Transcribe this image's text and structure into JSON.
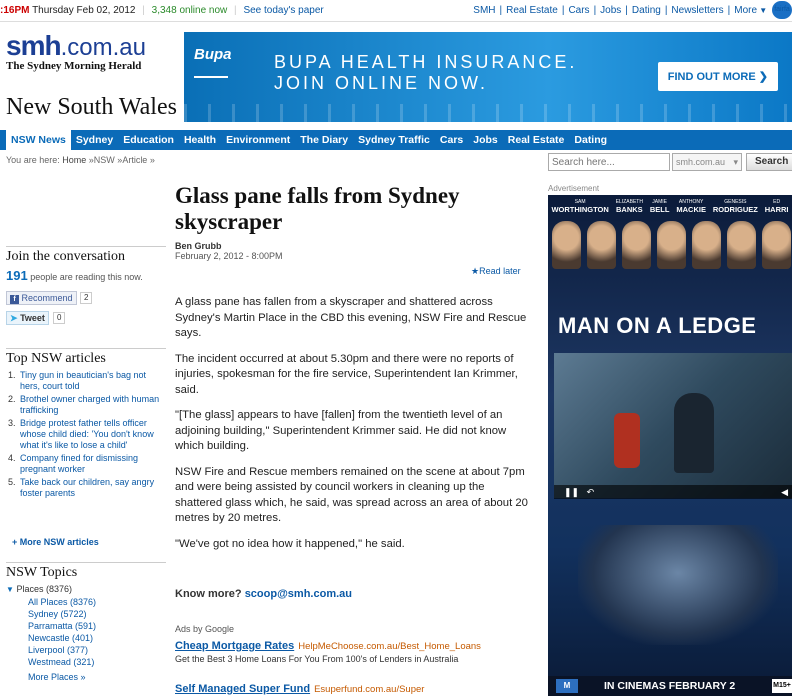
{
  "topbar": {
    "time": ":16PM",
    "date": "Thursday Feb 02, 2012",
    "online": "3,348 online now",
    "paper_link": "See today's paper",
    "links": [
      "SMH",
      "Real Estate",
      "Cars",
      "Jobs",
      "Dating",
      "Newsletters",
      "More"
    ],
    "fairfax": "fairfa"
  },
  "logo": {
    "smh": "smh",
    "domain": ".com.au",
    "masthead": "The Sydney Morning Herald"
  },
  "section_title": "New South Wales",
  "banner": {
    "brand": "Bupa",
    "headline_1": "BUPA HEALTH INSURANCE.",
    "headline_2": "JOIN ONLINE NOW.",
    "cta": "FIND OUT MORE ❯",
    "brand_color": "#0a6fb6"
  },
  "nav": {
    "items": [
      "NSW News",
      "Sydney",
      "Education",
      "Health",
      "Environment",
      "The Diary",
      "Sydney Traffic",
      "Cars",
      "Jobs",
      "Real Estate",
      "Dating"
    ],
    "color": "#0b6bb8"
  },
  "breadcrumb": {
    "prefix": "You are here:",
    "home": "Home",
    "sep": "»",
    "nsw": "NSW",
    "article": "Article"
  },
  "search": {
    "placeholder": "Search here...",
    "scope": "smh.com.au",
    "button": "Search"
  },
  "join": {
    "heading": "Join the conversation",
    "count": "191",
    "count_suffix": "people are reading this now.",
    "recommend": "Recommend",
    "recommend_count": "2",
    "tweet": "Tweet",
    "tweet_count": "0"
  },
  "top_articles": {
    "heading": "Top NSW articles",
    "items": [
      "Tiny gun in beautician's bag not hers, court told",
      "Brothel owner charged with human trafficking",
      "Bridge protest father tells officer whose child died: 'You don't know what it's like to lose a child'",
      "Company fined for dismissing pregnant worker",
      "Take back our children, say angry foster parents"
    ],
    "more": "More NSW articles"
  },
  "topics": {
    "heading": "NSW Topics",
    "places_header": "Places (8376)",
    "places": [
      "All Places (8376)",
      "Sydney (5722)",
      "Parramatta (591)",
      "Newcastle (401)",
      "Liverpool (377)",
      "Westmead (321)"
    ],
    "more": "More Places »"
  },
  "article": {
    "headline": "Glass pane falls from Sydney skyscraper",
    "author": "Ben Grubb",
    "date": "February 2, 2012 - 8:00PM",
    "read_later": "★Read later",
    "paragraphs": [
      "A glass pane has fallen from a skyscraper and shattered across Sydney's Martin Place in the CBD this evening, NSW Fire and Rescue says.",
      "The incident occurred at about 5.30pm and there were no reports of injuries, spokesman for the fire service, Superintendent Ian Krimmer, said.",
      "\"[The glass] appears to have [fallen] from the twentieth level of an adjoining building,\" Superintendent Krimmer said. He did not know which building.",
      "NSW Fire and Rescue members remained on the scene at about 7pm and were being assisted by council workers in cleaning up the shattered glass which, he said, was spread across an area of about 20 metres by 20 metres.",
      "\"We've got no idea how it happened,\" he said."
    ],
    "know_more": "Know more?",
    "know_more_email": "scoop@smh.com.au",
    "ads_by": "Ads by Google",
    "ads": [
      {
        "title": "Cheap Mortgage Rates",
        "url": "HelpMeChoose.com.au/Best_Home_Loans",
        "desc": "Get the Best 3 Home Loans For You From 100's of Lenders in Australia"
      },
      {
        "title": "Self Managed Super Fund",
        "url": "Esuperfund.com.au/Super",
        "desc": ""
      }
    ]
  },
  "right_ad": {
    "label": "Advertisement",
    "cast": [
      {
        "first": "SAM",
        "last": "WORTHINGTON"
      },
      {
        "first": "ELIZABETH",
        "last": "BANKS"
      },
      {
        "first": "JAMIE",
        "last": "BELL"
      },
      {
        "first": "ANTHONY",
        "last": "MACKIE"
      },
      {
        "first": "GENESIS",
        "last": "RODRIGUEZ"
      },
      {
        "first": "ED",
        "last": "HARRI"
      }
    ],
    "title": "MAN ON A LEDGE",
    "footer": "IN CINEMAS FEBRUARY 2",
    "play_label": "M",
    "rating": "M15+"
  }
}
